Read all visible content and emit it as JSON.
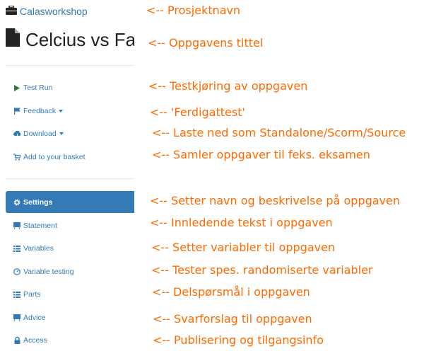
{
  "project": {
    "name": "Calasworkshop",
    "icon": "briefcase-icon"
  },
  "exercise": {
    "title": "Celcius vs Fahrenheit",
    "icon": "file-icon"
  },
  "actions": [
    {
      "label": "Test Run",
      "icon": "play-icon"
    },
    {
      "label": "Feedback",
      "icon": "flag-icon"
    },
    {
      "label": "Download",
      "icon": "cloud-download-icon"
    },
    {
      "label": "Add to your basket",
      "icon": "cart-icon"
    }
  ],
  "menu": [
    {
      "label": "Settings",
      "icon": "gear-icon",
      "active": true
    },
    {
      "label": "Statement",
      "icon": "blackboard-icon"
    },
    {
      "label": "Variables",
      "icon": "list-icon"
    },
    {
      "label": "Variable testing",
      "icon": "dashboard-icon"
    },
    {
      "label": "Parts",
      "icon": "list-icon"
    },
    {
      "label": "Advice",
      "icon": "blackboard-icon"
    },
    {
      "label": "Access",
      "icon": "lock-icon"
    }
  ],
  "annotations": [
    "<-- Prosjektnavn",
    "<-- Oppgavens tittel",
    "<-- Testkjøring av oppgaven",
    "<-- 'Ferdigattest'",
    "<-- Laste ned som Standalone/Scorm/Source",
    "<-- Samler oppgaver til feks. eksamen",
    "<-- Setter navn og beskrivelse på oppgaven",
    "<-- Innledende tekst i oppgaven",
    "<-- Setter variabler til oppgaven",
    "<-- Tester spes. randomiserte variabler",
    "<-- Delspørsmål i oppgaven",
    "<-- Svarforslag til oppgaven",
    "<-- Publisering og tilgangsinfo"
  ],
  "colors": {
    "link": "#337ab7",
    "active_bg": "#337ab7",
    "annotation": "#ff6a00"
  }
}
